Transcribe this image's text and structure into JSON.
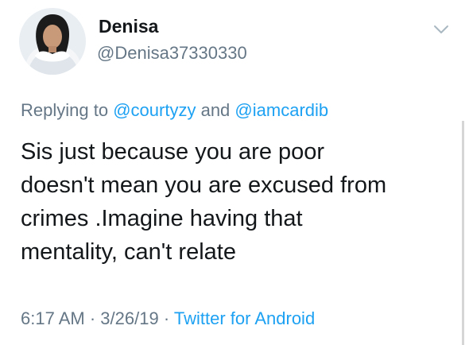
{
  "tweet": {
    "author": {
      "display_name": "Denisa",
      "handle": "@Denisa37330330"
    },
    "reply": {
      "prefix": "Replying to",
      "mention_1": "@courtyzy",
      "conjunction": "and",
      "mention_2": "@iamcardib"
    },
    "text_lines": [
      "Sis just because you are poor",
      "doesn't mean you are excused from",
      "crimes .Imagine having that",
      "mentality, can't relate"
    ],
    "meta": {
      "time": "6:17 AM",
      "separator": "·",
      "date": "3/26/19",
      "source": "Twitter for Android"
    }
  },
  "colors": {
    "link": "#1da1f2",
    "secondary_text": "#657786",
    "primary_text": "#14171a"
  },
  "icons": {
    "caret": "chevron-down-icon",
    "avatar": "user-avatar"
  }
}
